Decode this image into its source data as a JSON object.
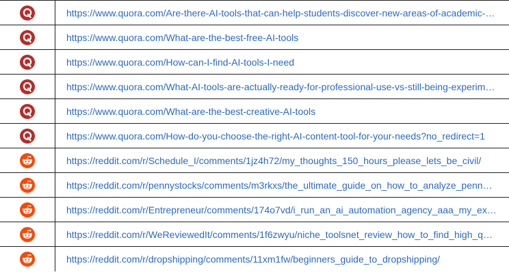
{
  "rows": [
    {
      "icon": "quora-icon",
      "url": "https://www.quora.com/Are-there-AI-tools-that-can-help-students-discover-new-areas-of-academic-interest"
    },
    {
      "icon": "quora-icon",
      "url": "https://www.quora.com/What-are-the-best-free-AI-tools"
    },
    {
      "icon": "quora-icon",
      "url": "https://www.quora.com/How-can-I-find-AI-tools-I-need"
    },
    {
      "icon": "quora-icon",
      "url": "https://www.quora.com/What-AI-tools-are-actually-ready-for-professional-use-vs-still-being-experimental"
    },
    {
      "icon": "quora-icon",
      "url": "https://www.quora.com/What-are-the-best-creative-AI-tools"
    },
    {
      "icon": "quora-icon",
      "url": "https://www.quora.com/How-do-you-choose-the-right-AI-content-tool-for-your-needs?no_redirect=1"
    },
    {
      "icon": "reddit-icon",
      "url": "https://reddit.com/r/Schedule_I/comments/1jz4h72/my_thoughts_150_hours_please_lets_be_civil/"
    },
    {
      "icon": "reddit-icon",
      "url": "https://reddit.com/r/pennystocks/comments/m3rkxs/the_ultimate_guide_on_how_to_analyze_penny_stocks/"
    },
    {
      "icon": "reddit-icon",
      "url": "https://reddit.com/r/Entrepreneur/comments/174o7vd/i_run_an_ai_automation_agency_aaa_my_experience/"
    },
    {
      "icon": "reddit-icon",
      "url": "https://reddit.com/r/WeReviewedIt/comments/1f6zwyu/niche_toolsnet_review_how_to_find_high_quality/"
    },
    {
      "icon": "reddit-icon",
      "url": "https://reddit.com/r/dropshipping/comments/11xm1fw/beginners_guide_to_dropshipping/"
    }
  ],
  "colors": {
    "link": "#2a6ac8",
    "quora": "#b92b27",
    "reddit": "#ff4500",
    "border": "#202020"
  }
}
